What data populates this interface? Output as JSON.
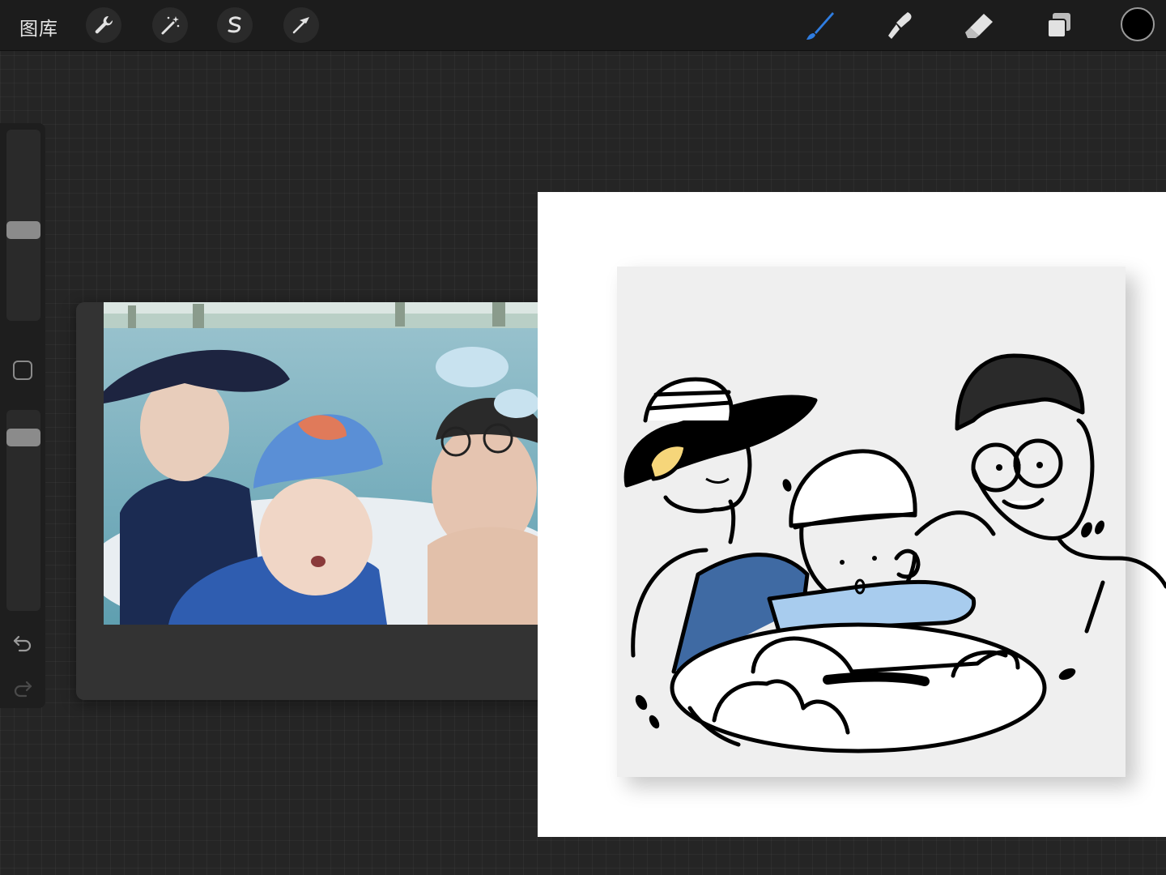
{
  "toolbar": {
    "gallery_label": "图库",
    "left_tools": [
      {
        "name": "actions",
        "icon": "wrench-icon"
      },
      {
        "name": "adjustments",
        "icon": "magic-wand-icon"
      },
      {
        "name": "selection",
        "icon": "selection-s-icon"
      },
      {
        "name": "transform",
        "icon": "arrow-cursor-icon"
      }
    ],
    "right_tools": [
      {
        "name": "brush",
        "icon": "brush-icon",
        "active": true
      },
      {
        "name": "smudge",
        "icon": "smudge-icon",
        "active": false
      },
      {
        "name": "eraser",
        "icon": "eraser-icon",
        "active": false
      },
      {
        "name": "layers",
        "icon": "layers-icon",
        "active": false
      }
    ],
    "current_color": "#000000",
    "accent_color": "#2f7de1"
  },
  "sidebar": {
    "brush_size_level": 0.47,
    "opacity_level": 0.9,
    "undo_icon": "undo-icon",
    "redo_icon": "redo-icon"
  },
  "reference": {
    "image": "family-pool-selfie-photo"
  },
  "canvas": {
    "background": "#ffffff",
    "artwork": "line-art-family-in-swim-ring"
  }
}
